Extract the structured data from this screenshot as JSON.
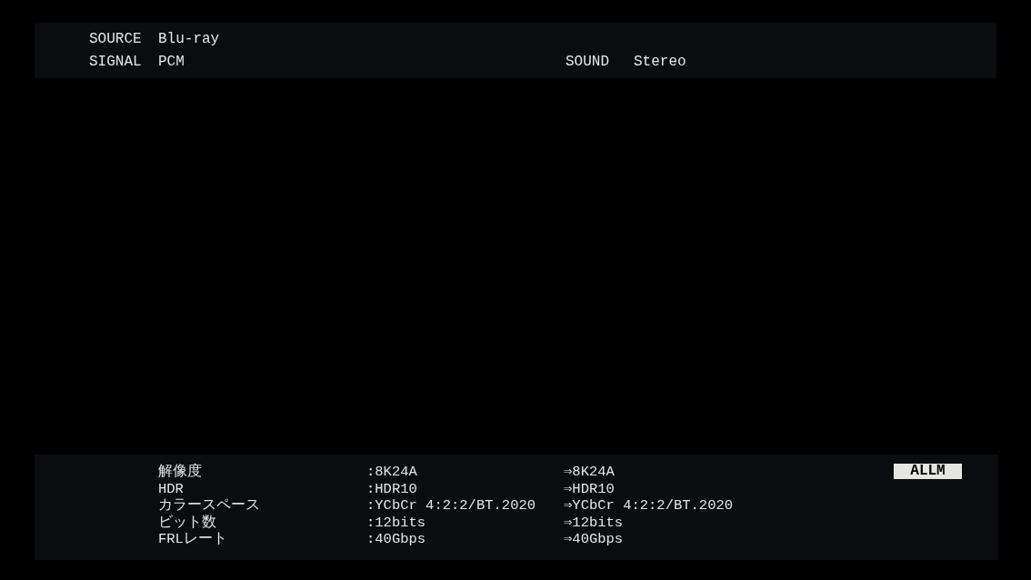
{
  "info_panel": {
    "rows": [
      {
        "label": "SOURCE",
        "value": "Blu-ray"
      },
      {
        "label": "SIGNAL",
        "value": "PCM"
      }
    ],
    "sound": {
      "label": "SOUND",
      "value": "Stereo"
    }
  },
  "signal_panel": {
    "rows": [
      {
        "label": "解像度",
        "input": ":8K24A",
        "output": "⇒8K24A"
      },
      {
        "label": "HDR",
        "input": ":HDR10",
        "output": "⇒HDR10"
      },
      {
        "label": "カラースペース",
        "input": ":YCbCr 4:2:2/BT.2020",
        "output": "⇒YCbCr 4:2:2/BT.2020"
      },
      {
        "label": "ビット数",
        "input": ":12bits",
        "output": "⇒12bits"
      },
      {
        "label": "FRLレート",
        "input": ":40Gbps",
        "output": "⇒40Gbps"
      }
    ],
    "badge": "ALLM"
  }
}
